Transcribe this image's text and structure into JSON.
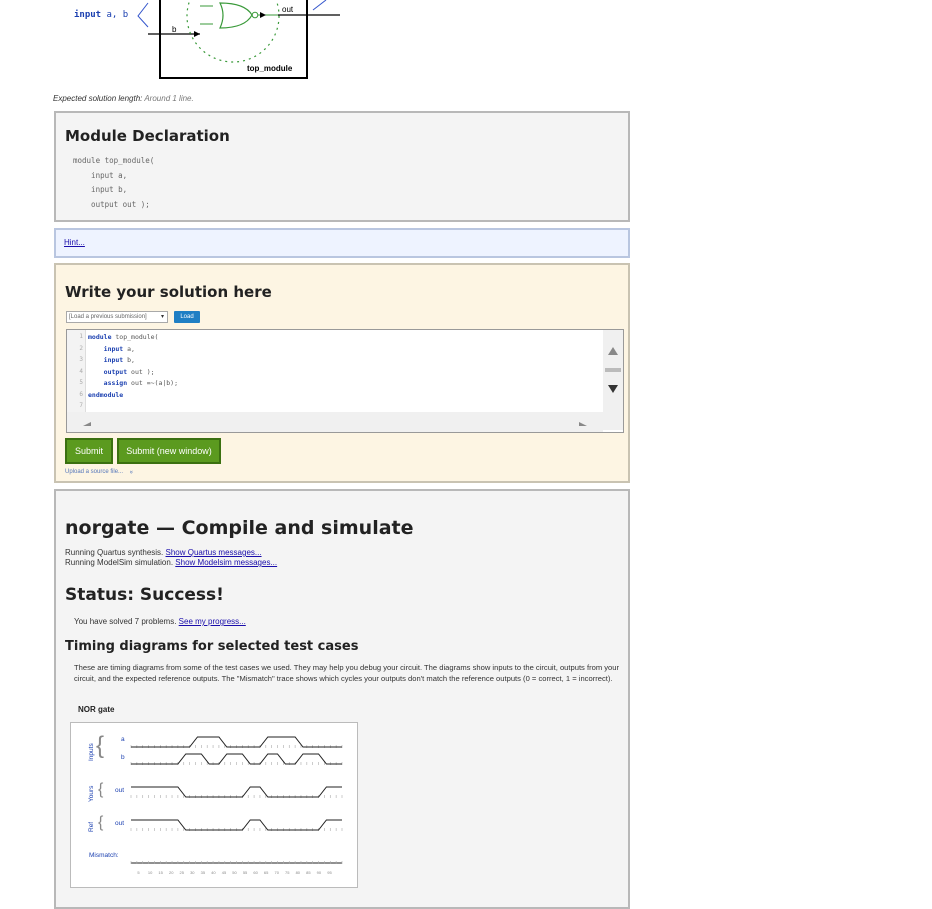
{
  "diagram": {
    "input_keyword": "input",
    "input_vars": "a, b",
    "wire_b": "b",
    "out_label": "out",
    "module_name": "top_module"
  },
  "expected": {
    "label": "Expected solution length:",
    "value": "Around 1 line."
  },
  "declaration": {
    "title": "Module Declaration",
    "code": "module top_module(\n    input a,\n    input b,\n    output out );"
  },
  "hint": {
    "label": "Hint..."
  },
  "solution": {
    "title": "Write your solution here",
    "select_placeholder": "[Load a previous submission]",
    "load_label": "Load",
    "code_lines": [
      {
        "num": "1",
        "kw": "module",
        "rest": " top_module("
      },
      {
        "num": "2",
        "kw": "    input",
        "rest": " a,"
      },
      {
        "num": "3",
        "kw": "    input",
        "rest": " b,"
      },
      {
        "num": "4",
        "kw": "    output",
        "rest": " out );"
      },
      {
        "num": "5",
        "kw": "    assign",
        "rest": " out =~(a|b);"
      },
      {
        "num": "6",
        "kw": "endmodule",
        "rest": ""
      },
      {
        "num": "7",
        "kw": "",
        "rest": ""
      }
    ],
    "submit_label": "Submit",
    "submit_new_label": "Submit (new window)",
    "upload_label": "Upload a source file...",
    "upload_chevron": "»"
  },
  "result": {
    "title": "norgate — Compile and simulate",
    "quartus_text": "Running Quartus synthesis.",
    "quartus_link": "Show Quartus messages...",
    "modelsim_text": "Running ModelSim simulation.",
    "modelsim_link": "Show Modelsim messages...",
    "status": "Status: Success!",
    "solved_text": "You have solved 7 problems.",
    "progress_link": "See my progress...",
    "timing_title": "Timing diagrams for selected test cases",
    "timing_desc": "These are timing diagrams from some of the test cases we used. They may help you debug your circuit. The diagrams show inputs to the circuit, outputs from your circuit, and the expected reference outputs. The \"Mismatch\" trace shows which cycles your outputs don't match the reference outputs (0 = correct, 1 = incorrect).",
    "wave_title": "NOR gate"
  },
  "waveform": {
    "group_inputs": "Inputs",
    "group_yours": "Yours",
    "group_ref": "Ref",
    "signal_a": "a",
    "signal_b": "b",
    "signal_out_yours": "out",
    "signal_out_ref": "out",
    "mismatch_label": "Mismatch:",
    "ticks": [
      "5",
      "10",
      "15",
      "20",
      "25",
      "30",
      "35",
      "40",
      "45",
      "50",
      "55",
      "60",
      "65",
      "70",
      "75",
      "80",
      "85",
      "90",
      "95"
    ],
    "a_levels": [
      0,
      0,
      0,
      0,
      0,
      0,
      0,
      0,
      0,
      0,
      0,
      1,
      1,
      1,
      1,
      1,
      0,
      0,
      0,
      0,
      0,
      0,
      0,
      1,
      1,
      1,
      1,
      1,
      1,
      0,
      0,
      0,
      0,
      0,
      0,
      0
    ],
    "b_levels": [
      0,
      0,
      0,
      0,
      0,
      0,
      0,
      0,
      0,
      1,
      1,
      1,
      1,
      0,
      0,
      0,
      1,
      1,
      1,
      1,
      0,
      0,
      0,
      1,
      1,
      1,
      0,
      0,
      0,
      1,
      1,
      1,
      1,
      0,
      0,
      0
    ],
    "out_levels": [
      1,
      1,
      1,
      1,
      1,
      1,
      1,
      1,
      1,
      0,
      0,
      0,
      0,
      0,
      0,
      0,
      0,
      0,
      0,
      0,
      1,
      1,
      1,
      0,
      0,
      0,
      0,
      0,
      0,
      0,
      0,
      0,
      0,
      1,
      1,
      1
    ]
  },
  "colors": {
    "accent_link": "#1a0dab",
    "button_green": "#5b9a1f",
    "load_blue": "#1f7fc4",
    "signal_blue": "#1a3fb0"
  }
}
